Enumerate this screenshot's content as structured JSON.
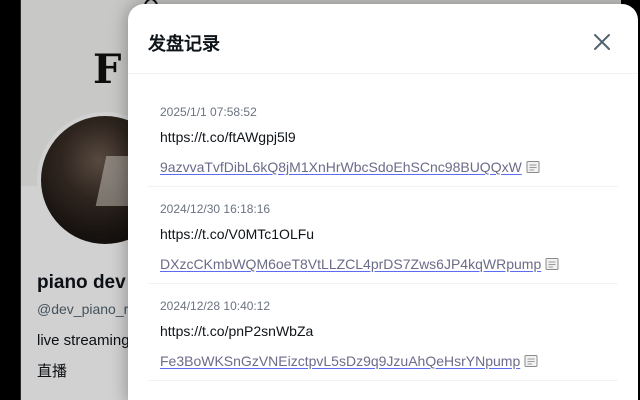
{
  "background_profile": {
    "banner_text": "F",
    "display_name": "piano dev",
    "handle": "@dev_piano_r",
    "bio": "live streaming",
    "tag": "直播"
  },
  "modal": {
    "title": "发盘记录",
    "records": [
      {
        "time": "2025/1/1 07:58:52",
        "link": "https://t.co/ftAWgpj5l9",
        "password": "9azvvaTvfDibL6kQ8jM1XnHrWbcSdoEhSCnc98BUQQxW"
      },
      {
        "time": "2024/12/30 16:18:16",
        "link": "https://t.co/V0MTc1OLFu",
        "password": "DXzcCKmbWQM6oeT8VtLLZCL4prDS7Zws6JP4kqWRpump"
      },
      {
        "time": "2024/12/28 10:40:12",
        "link": "https://t.co/pnP2snWbZa",
        "password": "Fe3BoWKSnGzVNEizctpvL5sDz9q9JzuAhQeHsrYNpump"
      }
    ]
  }
}
